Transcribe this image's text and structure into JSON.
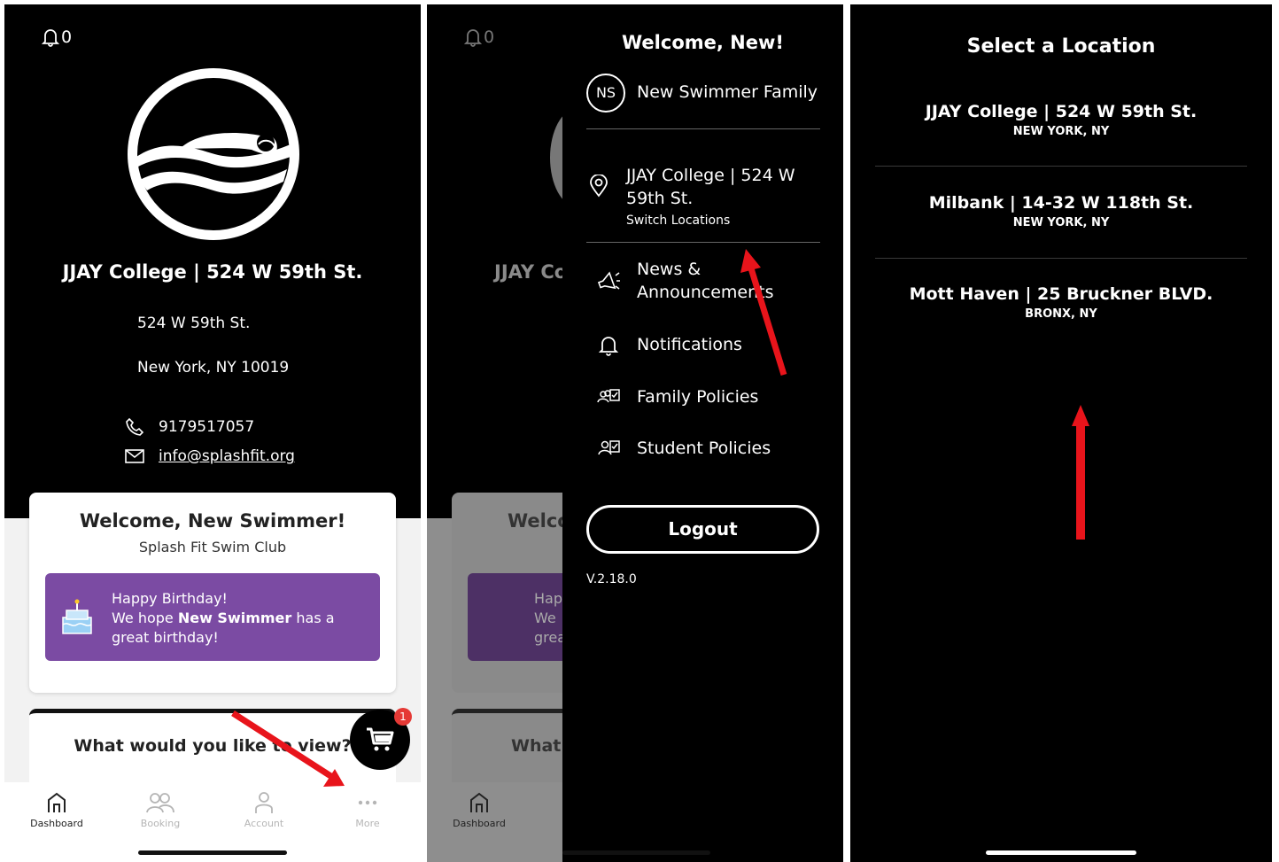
{
  "colors": {
    "purple": "#7b4ba3",
    "arrow": "#e8141b",
    "badge": "#e53935"
  },
  "screen1": {
    "notif_count": "0",
    "location_title": "JJAY College | 524 W 59th St.",
    "address_line1": "524 W 59th St.",
    "address_line2": "New York, NY 10019",
    "phone": "9179517057",
    "email": "info@splashfit.org",
    "welcome_title": "Welcome, New Swimmer!",
    "club_name": "Splash Fit Swim Club",
    "birthday_line1": "Happy Birthday!",
    "birthday_line2_pre": "We hope ",
    "birthday_line2_name": "New Swimmer",
    "birthday_line2_post": " has a",
    "birthday_line3": "great birthday!",
    "view_question": "What would you like to view?",
    "cart_badge": "1",
    "tabs": [
      {
        "label": "Dashboard",
        "icon": "home-icon"
      },
      {
        "label": "Booking",
        "icon": "people-icon"
      },
      {
        "label": "Account",
        "icon": "person-icon"
      },
      {
        "label": "More",
        "icon": "more-dots-icon"
      }
    ]
  },
  "screen2": {
    "notif_count": "0",
    "behind_title": "JJAY Co",
    "behind_welcome": "Welco",
    "behind_bday": [
      "Hap",
      "We",
      "grea"
    ],
    "behind_view": "What",
    "behind_tab": "Dashboard",
    "welcome": "Welcome, New!",
    "initials": "NS",
    "family_name": "New Swimmer Family",
    "location_line1": "JJAY College | 524 W",
    "location_line2": "59th St.",
    "switch_label": "Switch Locations",
    "menu": [
      {
        "line1": "News &",
        "line2": "Announcements",
        "icon": "megaphone-icon"
      },
      {
        "line1": "Notifications",
        "line2": "",
        "icon": "bell-icon"
      },
      {
        "line1": "Family Policies",
        "line2": "",
        "icon": "family-policies-icon"
      },
      {
        "line1": "Student Policies",
        "line2": "",
        "icon": "student-policies-icon"
      }
    ],
    "logout": "Logout",
    "version": "V.2.18.0"
  },
  "screen3": {
    "title": "Select a Location",
    "locations": [
      {
        "name": "JJAY College | 524 W 59th St.",
        "city": "NEW YORK, NY"
      },
      {
        "name": "Milbank | 14-32 W 118th St.",
        "city": "NEW YORK, NY"
      },
      {
        "name": "Mott Haven | 25 Bruckner BLVD.",
        "city": "BRONX, NY"
      }
    ]
  }
}
